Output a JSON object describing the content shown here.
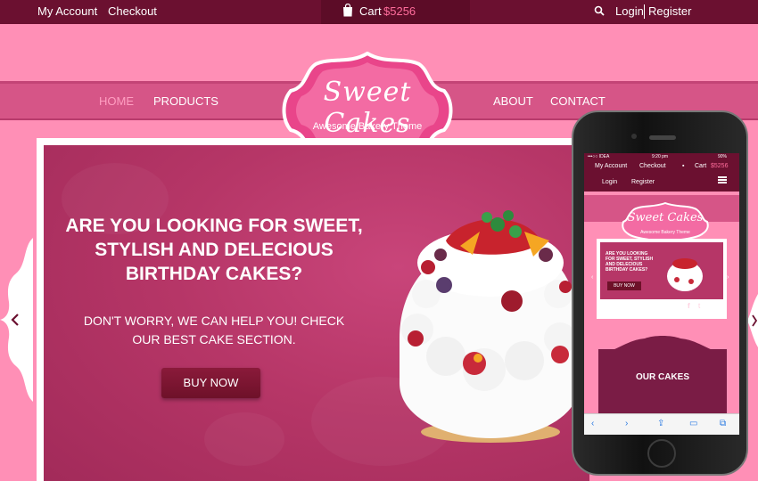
{
  "topbar": {
    "my_account": "My Account",
    "checkout": "Checkout",
    "cart_label": "Cart",
    "cart_total": "$5256",
    "login": "Login",
    "register": "Register"
  },
  "nav": {
    "items": [
      {
        "label": "HOME",
        "active": true
      },
      {
        "label": "PRODUCTS",
        "active": false
      },
      {
        "label": "ABOUT",
        "active": false
      },
      {
        "label": "CONTACT",
        "active": false
      }
    ]
  },
  "logo": {
    "script": "Sweet Cakes",
    "tagline": "Awesome Bakery Theme"
  },
  "hero": {
    "headline": "ARE YOU LOOKING FOR SWEET, STYLISH AND DELECIOUS BIRTHDAY CAKES?",
    "subtext": "DON'T WORRY, WE CAN HELP YOU! CHECK OUR BEST CAKE SECTION.",
    "button": "BUY NOW"
  },
  "phone": {
    "status_left": "•••○○ IDEA",
    "status_time": "9:20 pm",
    "status_right": "90%",
    "my_account": "My Account",
    "checkout": "Checkout",
    "cart_label": "Cart",
    "cart_total": "$5256",
    "login": "Login",
    "register": "Register",
    "logo_script": "Sweet Cakes",
    "logo_tagline": "Awesome Bakery Theme",
    "hero_headline": "ARE YOU LOOKING FOR SWEET, STYLISH AND DELECIOUS BIRTHDAY CAKES?",
    "hero_button": "BUY NOW",
    "share_on": "SHARE ON",
    "section_title": "OUR CAKES"
  },
  "colors": {
    "page_bg": "#ff8fb6",
    "topbar": "#6b1030",
    "nav_band": "#d65587",
    "hero": "#b63667",
    "accent_price": "#ff6d9c",
    "button": "#7a142f"
  },
  "icons": [
    "shopping-bag-icon",
    "search-icon",
    "chevron-left-icon",
    "chevron-right-icon",
    "hamburger-menu-icon",
    "facebook-icon",
    "twitter-icon"
  ]
}
